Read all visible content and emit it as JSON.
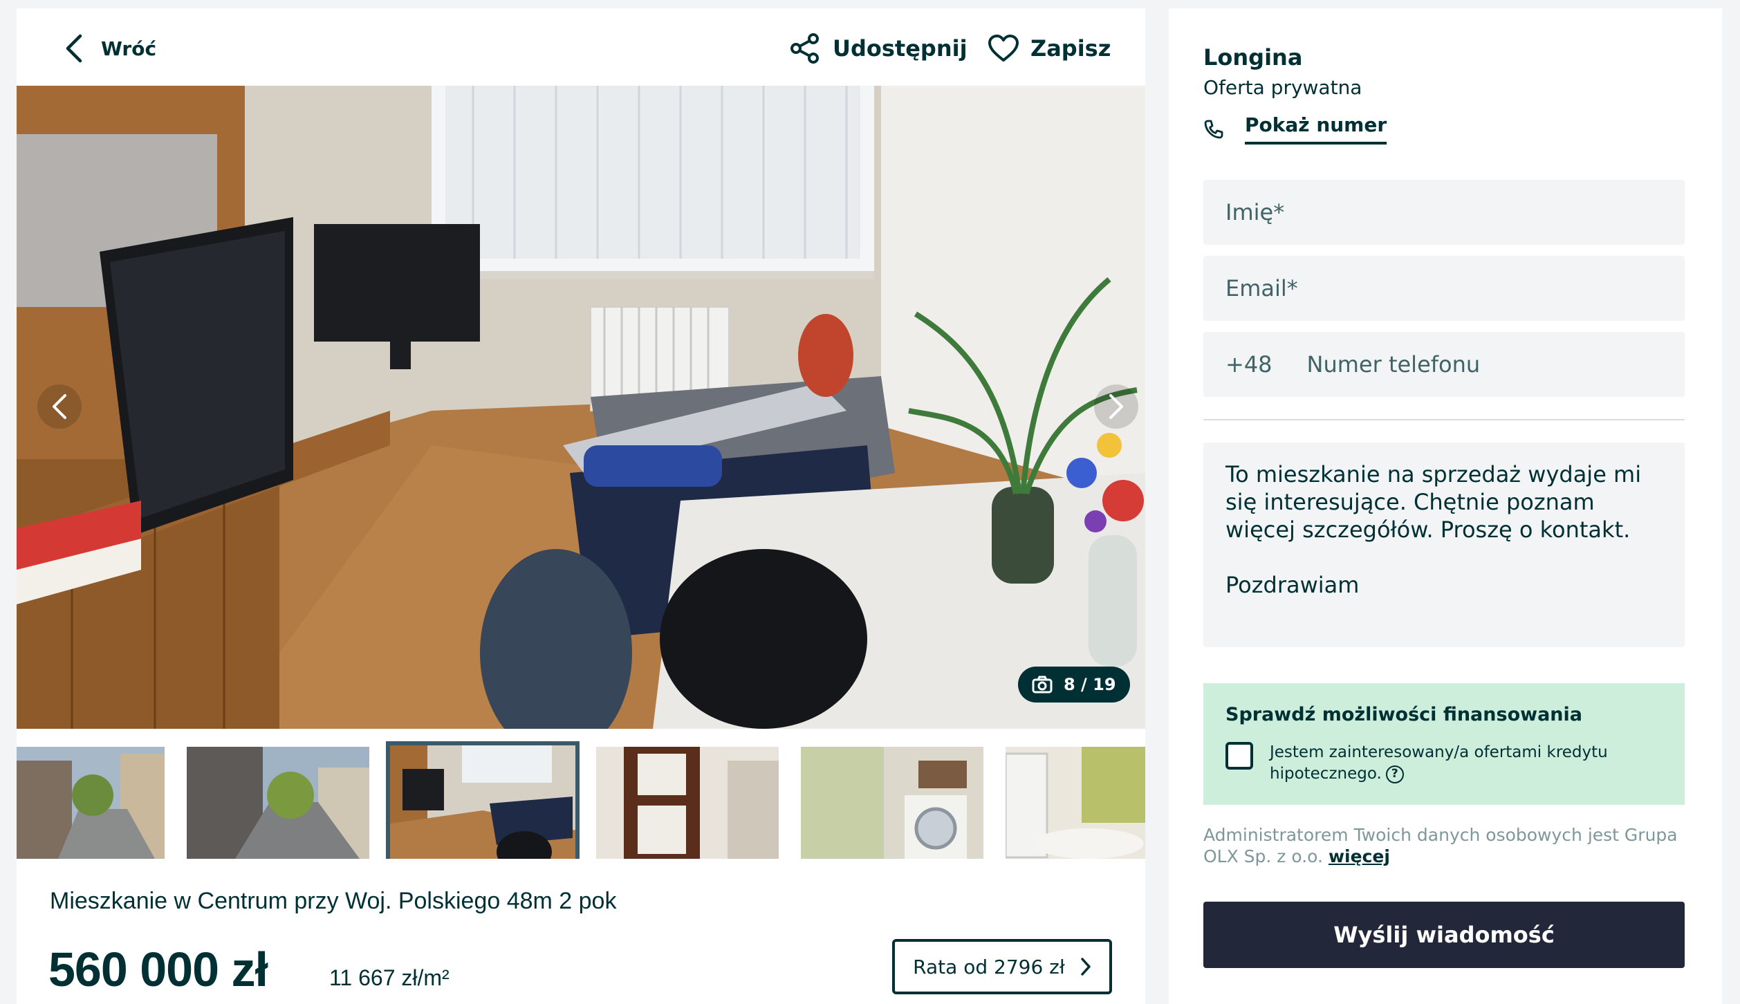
{
  "header": {
    "back_label": "Wróć",
    "share_label": "Udostępnij",
    "save_label": "Zapisz"
  },
  "gallery": {
    "counter": "8 / 19",
    "thumbnails": [
      "street-view-1",
      "street-view-2",
      "living-room",
      "door",
      "bathroom-washer",
      "bathroom-radiator"
    ],
    "active_thumbnail": 2
  },
  "listing": {
    "title": "Mieszkanie w Centrum przy Woj. Polskiego 48m 2 pok",
    "price": "560 000 zł",
    "price_per_m2": "11 667 zł/m²",
    "installment_label": "Rata od 2796 zł"
  },
  "seller": {
    "name": "Longina",
    "type": "Oferta prywatna",
    "show_number_label": "Pokaż numer"
  },
  "form": {
    "name_placeholder": "Imię*",
    "email_placeholder": "Email*",
    "phone_prefix": "+48",
    "phone_placeholder": "Numer telefonu",
    "message_line1": "To mieszkanie na sprzedaż wydaje mi się interesujące. Chętnie poznam więcej szczegółów. Proszę o kontakt.",
    "message_line2": "Pozdrawiam",
    "finance_heading": "Sprawdź możliwości finansowania",
    "finance_checkbox_label": "Jestem zainteresowany/a ofertami kredytu hipotecznego.",
    "admin_text": "Administratorem Twoich danych osobowych jest Grupa OLX Sp. z o.o.",
    "admin_more": "więcej",
    "send_label": "Wyślij wiadomość"
  },
  "colors": {
    "text": "#002f34",
    "finance_bg": "#cdeedb",
    "send_bg": "#23273a",
    "field_bg": "#f2f4f5"
  }
}
